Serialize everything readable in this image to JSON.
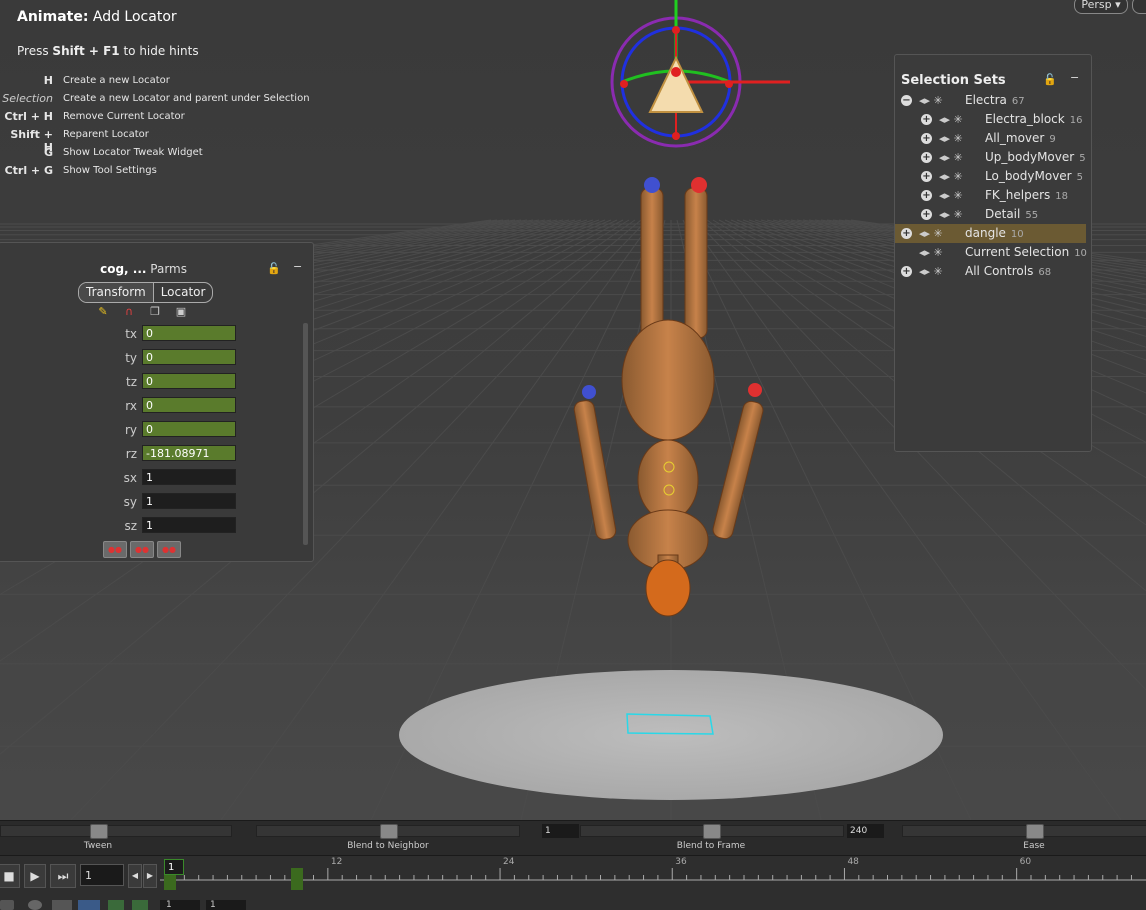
{
  "hints": {
    "title_prefix": "Animate:",
    "title_rest": "Add Locator",
    "sub_press": "Press",
    "sub_keys": "Shift + F1",
    "sub_rest": "to hide hints",
    "rows": [
      {
        "key": "H",
        "desc": "Create a new Locator"
      },
      {
        "key": "Selection",
        "desc": "Create a new Locator and parent under Selection"
      },
      {
        "key": "Ctrl + H",
        "desc": "Remove Current Locator"
      },
      {
        "key": "Shift + H",
        "desc": "Reparent Locator"
      },
      {
        "key": "G",
        "desc": "Show Locator Tweak Widget"
      },
      {
        "key": "Ctrl + G",
        "desc": "Show Tool Settings"
      }
    ]
  },
  "viewport": {
    "camera_label": "Persp ▾"
  },
  "parms": {
    "title_bold": "cog, ...",
    "title_rest": "Parms",
    "tabs": [
      "Transform",
      "Locator"
    ],
    "fields": [
      {
        "label": "tx",
        "value": "0",
        "style": "green"
      },
      {
        "label": "ty",
        "value": "0",
        "style": "green"
      },
      {
        "label": "tz",
        "value": "0",
        "style": "green"
      },
      {
        "label": "rx",
        "value": "0",
        "style": "green"
      },
      {
        "label": "ry",
        "value": "0",
        "style": "green"
      },
      {
        "label": "rz",
        "value": "-181.08971",
        "style": "green"
      },
      {
        "label": "sx",
        "value": "1",
        "style": "dark"
      },
      {
        "label": "sy",
        "value": "1",
        "style": "dark"
      },
      {
        "label": "sz",
        "value": "1",
        "style": "dark"
      }
    ]
  },
  "selection_sets": {
    "title": "Selection Sets",
    "items": [
      {
        "name": "Electra",
        "count": "67",
        "expand": "−",
        "indent": 0
      },
      {
        "name": "Electra_block",
        "count": "16",
        "expand": "+",
        "indent": 1
      },
      {
        "name": "All_mover",
        "count": "9",
        "expand": "+",
        "indent": 1
      },
      {
        "name": "Up_bodyMover",
        "count": "5",
        "expand": "+",
        "indent": 1
      },
      {
        "name": "Lo_bodyMover",
        "count": "5",
        "expand": "+",
        "indent": 1
      },
      {
        "name": "FK_helpers",
        "count": "18",
        "expand": "+",
        "indent": 1
      },
      {
        "name": "Detail",
        "count": "55",
        "expand": "+",
        "indent": 1
      },
      {
        "name": "dangle",
        "count": "10",
        "expand": "+",
        "indent": 0,
        "highlight": true
      },
      {
        "name": "Current Selection",
        "count": "10",
        "expand": "",
        "indent": 0
      },
      {
        "name": "All Controls",
        "count": "68",
        "expand": "+",
        "indent": 0
      }
    ]
  },
  "slider_bar": {
    "labels": [
      "Tween",
      "Blend to Neighbor",
      "Blend to Frame",
      "Ease"
    ],
    "field_start": "1",
    "field_end": "240"
  },
  "timeline": {
    "frame_value": "1",
    "current_frame": "1",
    "tick_labels": [
      "12",
      "24",
      "36",
      "48",
      "60"
    ],
    "bottom_fields": [
      "1",
      "1"
    ]
  }
}
